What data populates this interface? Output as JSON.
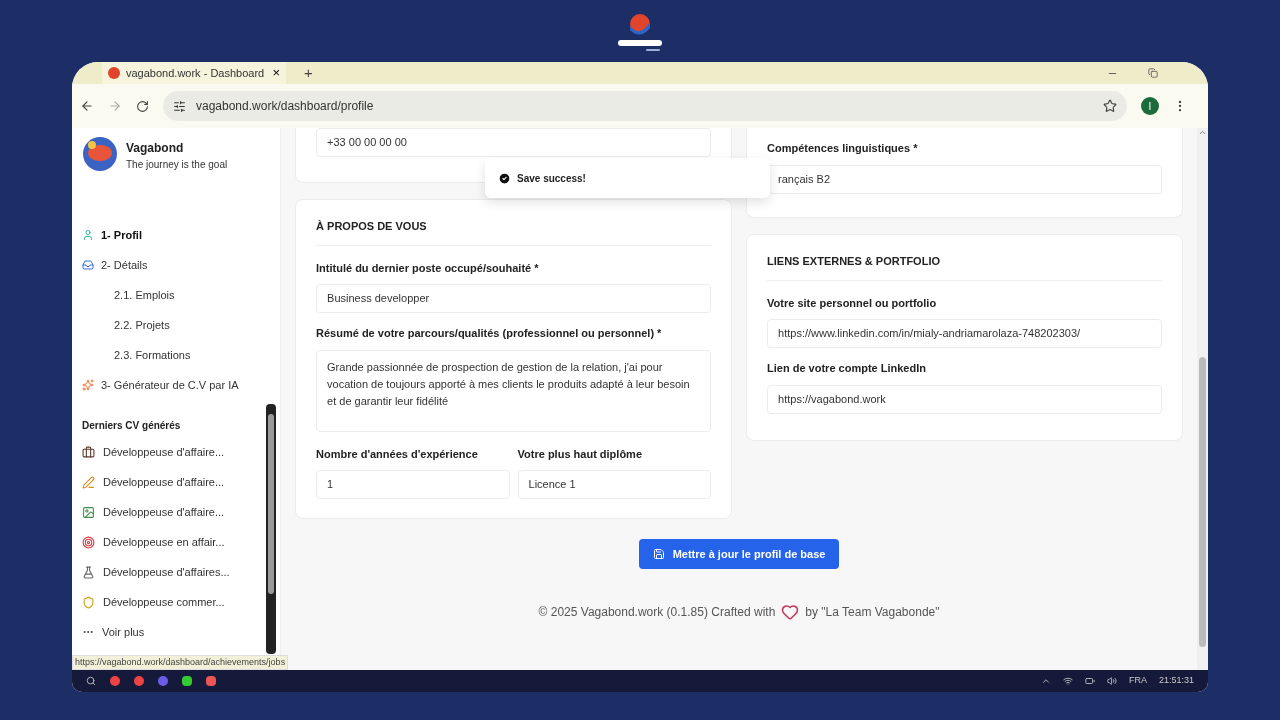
{
  "browser": {
    "tab_title": "vagabond.work - Dashboard",
    "tab_close": "×",
    "new_tab": "+",
    "url": "vagabond.work/dashboard/profile",
    "profile_initial": "I"
  },
  "sidebar": {
    "brand": "Vagabond",
    "tagline": "The journey is the goal",
    "nav": [
      {
        "label": "1- Profil",
        "selected": true
      },
      {
        "label": "2- Détails",
        "selected": false,
        "children": [
          {
            "label": "2.1. Emplois"
          },
          {
            "label": "2.2. Projets"
          },
          {
            "label": "2.3. Formations"
          }
        ]
      },
      {
        "label": "3- Générateur de C.V par IA",
        "selected": false
      }
    ],
    "recent_heading": "Derniers CV générés",
    "recent": [
      {
        "label": "Développeuse d'affaire..."
      },
      {
        "label": "Développeuse d'affaire..."
      },
      {
        "label": "Développeuse d'affaire..."
      },
      {
        "label": "Développeuse en affair..."
      },
      {
        "label": "Développeuse d'affaires..."
      },
      {
        "label": "Développeuse commer..."
      }
    ],
    "more": "Voir plus"
  },
  "toast": {
    "text": "Save success!"
  },
  "top_left_field": {
    "value": "+33 00 00 00 00"
  },
  "top_right": {
    "label": "Compétences linguistiques *",
    "value": "rançais B2"
  },
  "about": {
    "title": "À PROPOS DE VOUS",
    "job_label": "Intitulé du dernier poste occupé/souhaité *",
    "job_value": "Business developper",
    "summary_label": "Résumé de votre parcours/qualités (professionnel ou personnel) *",
    "summary_value": "Grande passionnée de prospection de gestion de la relation, j'ai pour vocation de toujours apporté à mes clients le produits adapté à leur besoin et de garantir leur fidélité",
    "years_label": "Nombre d'années d'expérience",
    "years_value": "1",
    "degree_label": "Votre plus haut diplôme",
    "degree_value": "Licence 1"
  },
  "links": {
    "title": "LIENS EXTERNES & PORTFOLIO",
    "site_label": "Votre site personnel ou portfolio",
    "site_value": "https://www.linkedin.com/in/mialy-andriamarolaza-748202303/",
    "linkedin_label": "Lien de votre compte LinkedIn",
    "linkedin_value": "https://vagabond.work"
  },
  "submit": "Mettre à jour le profil de base",
  "footer": {
    "before": "© 2025 Vagabond.work (0.1.85) Crafted with",
    "after": "by \"La Team Vagabonde\""
  },
  "status_url": "https://vagabond.work/dashboard/achievements/jobs",
  "taskbar": {
    "language": "FRA",
    "time": "21:51:31"
  }
}
